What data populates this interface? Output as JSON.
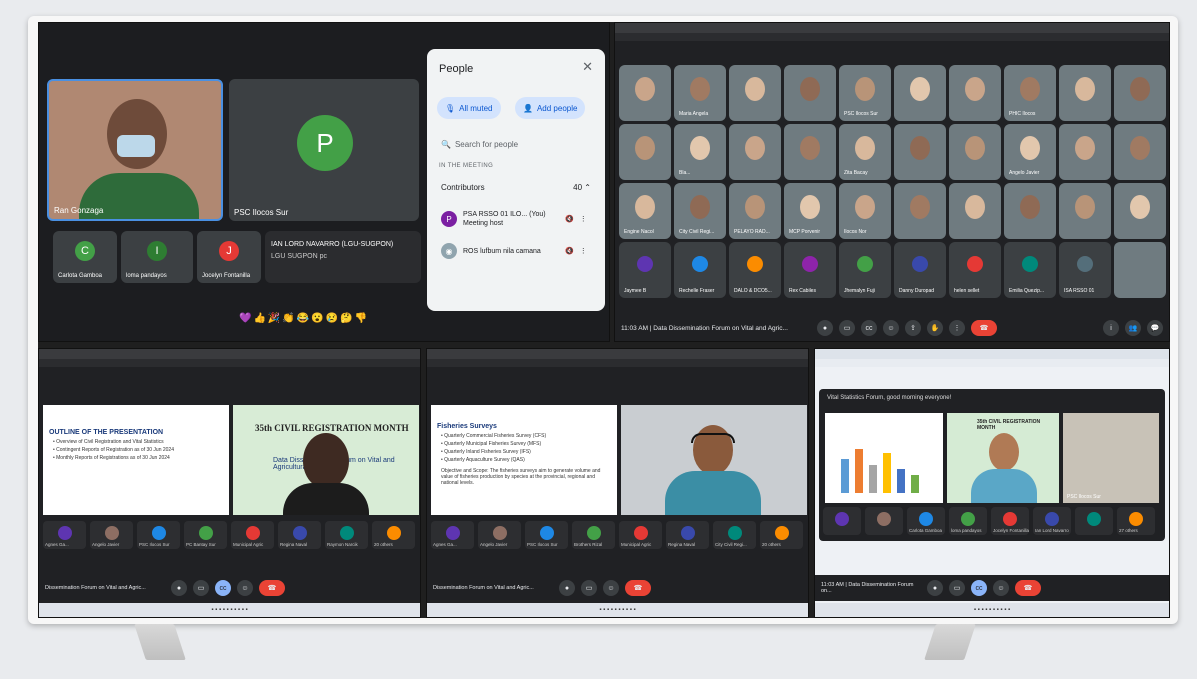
{
  "panel1": {
    "people_panel": {
      "title": "People",
      "all_unmuted": "All muted",
      "add_people": "Add people",
      "search_placeholder": "Search for people",
      "section": "IN THE MEETING",
      "contributors_label": "Contributors",
      "contributors_count": "40",
      "rows": [
        {
          "avatar": "P",
          "name": "PSA RSSO 01 ILO... (You) Meeting host",
          "color": "#7b1fa2"
        },
        {
          "avatar": "◉",
          "name": "ROS lufbum nila camana",
          "color": "#5f6368"
        }
      ]
    },
    "main_tiles": [
      {
        "name": "Ran Gonzaga",
        "kind": "video"
      },
      {
        "name": "PSC Ilocos Sur",
        "avatar": "P",
        "color": "#43a047"
      }
    ],
    "small_tiles": [
      {
        "name": "Carlota Gamboa",
        "avatar": "C",
        "color": "#43a047"
      },
      {
        "name": "loma pandayos",
        "avatar": "I",
        "color": "#2e7d32"
      },
      {
        "name": "Jocelyn Fontanilla",
        "avatar": "J",
        "color": "#e53935"
      }
    ],
    "presenting": "IAN LORD NAVARRO (LGU-SUGPON)",
    "presenting_sub": "LGU SUGPON pc",
    "reactions": "💜👍🎉👏😂😮😢🤔👎"
  },
  "panel2": {
    "time_meeting": "11:03 AM  |  Data Dissemination Forum on Vital and Agric...",
    "grid_names": [
      "",
      "",
      "",
      "",
      "",
      "",
      "",
      "",
      "",
      "",
      "",
      "",
      "",
      "",
      "",
      "",
      "",
      "",
      "",
      "",
      "",
      "",
      "",
      "",
      "",
      "",
      "",
      "",
      "",
      "",
      "Jaymee B",
      "Rechelle Fraser",
      "DALO & DCO5...",
      "Rex Cabiles",
      "Jhemalyn Fuji",
      "Danny Duropad",
      "helen sellet",
      "Emilia Quezip...",
      "ISA RSSO 01"
    ],
    "grid_named": [
      "Maria Angela",
      "PSC Ilocos Sur",
      "PHIC Ilocos",
      "Bla...",
      "Zita Bacay",
      "Angelo Javier",
      "Engine Nacol",
      "City Civil Regi...",
      "PELAYO RAD...",
      "MCP Porvenir",
      "Ilocos Nor"
    ],
    "grid_letters": [
      "R",
      "C",
      "P",
      "R",
      "D",
      "H",
      "E"
    ]
  },
  "panel3": {
    "slide_title": "OUTLINE OF THE PRESENTATION",
    "bullets": [
      "• Overview of Civil Registration and Vital Statistics",
      "• Contingent Reports of Registration as of 30 Jun 2024",
      "• Monthly Reports of Registrations as of 30 Jun 2024"
    ],
    "banner": "35th CIVIL REGISTRATION MONTH",
    "banner2": "Data Dissemination Forum on Vital and Agricultural Statistics",
    "strip": [
      "Agnes Ga...",
      "Angelo Javier",
      "PSC Ilocos Sur",
      "PC Bantay Sur",
      "Municipal Agric",
      "Regina Naval",
      "Raymon Narcik",
      "20 others"
    ],
    "footer": "Dissemination Forum on Vital and Agric..."
  },
  "panel4": {
    "slide_heading": "Fisheries Surveys",
    "bullets": [
      "• Quarterly Commercial Fisheries Survey (CFS)",
      "• Quarterly Municipal Fisheries Survey (MFS)",
      "• Quarterly Inland Fisheries Survey (IFS)",
      "• Quarterly Aquaculture Survey (QAS)",
      "Objective and Scope: The fisheries surveys aim to generate volume and value of fisheries production by species at the provincial, regional and national levels."
    ],
    "strip": [
      "Agnes Ga...",
      "Angelo Javier",
      "PSC Ilocos Sur",
      "Brothers Rizal",
      "Municipal Agric",
      "Regina Naval",
      "City Civil Regi...",
      "20 others"
    ],
    "footer": "Dissemination Forum on Vital and Agric..."
  },
  "panel5": {
    "greeting": "Vital Statistics Forum, good morning everyone!",
    "banner": "35th CIVIL REGISTRATION MONTH",
    "tile_label": "PSC Ilocos Sur",
    "strip": [
      "",
      "",
      "Carlota Gamboa",
      "loma pandayos",
      "Jocelyn Fontanilla",
      "Ian Lord Navarro",
      "",
      "27 others"
    ],
    "footer": "11:03 AM  |  Data Dissemination Forum on..."
  }
}
